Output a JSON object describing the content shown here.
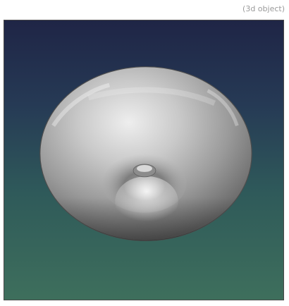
{
  "viewer": {
    "object_label": "(3d object)"
  },
  "model": {
    "shape": "torus",
    "material_color": "#b9b9b9",
    "background_top_color": "#1f2546",
    "background_bottom_color": "#3e6f5c"
  }
}
